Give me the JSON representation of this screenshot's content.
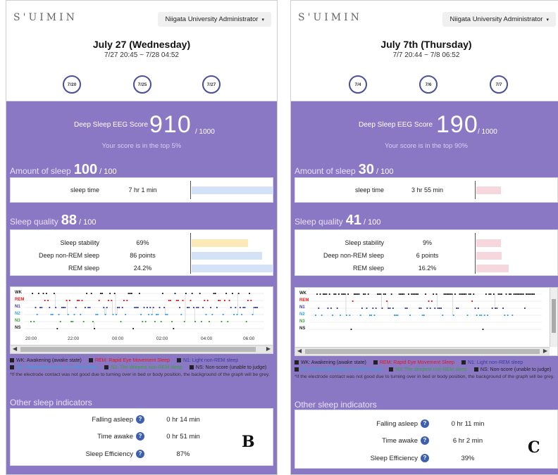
{
  "app": {
    "logo": "S'UIMIN",
    "admin_label": "Niigata University Administrator",
    "admin_caret": "▾"
  },
  "colors": {
    "accent": "#8a78c4",
    "wake": "#222222",
    "rem": "#e01818",
    "n1": "#3b3a9a",
    "n2": "#36a2dc",
    "n3": "#3aa13a",
    "ns": "#222222",
    "bar_blue": "#d3e2f6",
    "bar_yellow": "#fbeab8",
    "bar_pink": "#f6d7dd"
  },
  "legend": {
    "wk": "WK: Awakening (awake state)",
    "rem": "REM: Rapid Eye Movement Sleep",
    "n1": "N1: Light non-REM sleep",
    "n2": "N2: Moderately deep non-REM sleep",
    "n3": "N3: The deepest non-REM sleep",
    "ns": "NS: Non-score (unable to judge)",
    "note": "*If the electrode contact was not good due to turning over in bed or body position, the background of the graph will be grey."
  },
  "stages": {
    "wk": "WK",
    "rem": "REM",
    "n1": "N1",
    "n2": "N2",
    "n3": "N3",
    "ns": "NS"
  },
  "labels": {
    "score_label": "Deep Sleep EEG Score",
    "score_max": "/ 1000",
    "amount": "Amount of sleep",
    "quality": "Sleep quality",
    "per100": "/ 100",
    "sleep_time": "sleep time",
    "stability": "Sleep stability",
    "deep_nrem": "Deep non-REM sleep",
    "rem_sleep": "REM sleep",
    "other": "Other sleep indicators",
    "falling": "Falling asleep",
    "awake": "Time awake",
    "efficiency": "Sleep Efficiency",
    "qmark": "?"
  },
  "panels": [
    {
      "letter": "B",
      "date": "July 27 (Wednesday)",
      "range": "7/27 20:45 ~ 7/28 04:52",
      "nav": [
        "7/20",
        "7/25",
        "7/27"
      ],
      "score": "910",
      "top": "Your score is in the top 5%",
      "amount": "100",
      "sleep_time": "7 hr 1 min",
      "quality": "88",
      "stability": "69%",
      "deep_nrem": "86 points",
      "rem": "24.2%",
      "bars": {
        "sleep_time": 1.0,
        "stability": 0.69,
        "deep_nrem": 0.86,
        "rem": 1.0
      },
      "bar_colors": [
        "#d3e2f6",
        "#fbeab8",
        "#d3e2f6",
        "#d3e2f6"
      ],
      "ticks": [
        "20:00",
        "22:00",
        "00:00",
        "02:00",
        "04:00",
        "06:00"
      ],
      "falling": "0 hr 14 min",
      "awake": "0 hr 51 min",
      "efficiency": "87%"
    },
    {
      "letter": "C",
      "date": "July 7th (Thursday)",
      "range": "7/7 20:44 ~ 7/8 06:52",
      "nav": [
        "7/4",
        "7/6",
        "7/7"
      ],
      "score": "190",
      "top": "Your score is in the top 90%",
      "amount": "30",
      "sleep_time": "3 hr 55 min",
      "quality": "41",
      "stability": "9%",
      "deep_nrem": "6 points",
      "rem": "16.2%",
      "bars": {
        "sleep_time": 0.3,
        "stability": 0.3,
        "deep_nrem": 0.31,
        "rem": 0.4
      },
      "bar_colors": [
        "#f6d7dd",
        "#f6d7dd",
        "#f6d7dd",
        "#f6d7dd"
      ],
      "ticks": [],
      "falling": "0 hr 11 min",
      "awake": "6 hr 2 min",
      "efficiency": "39%"
    }
  ]
}
